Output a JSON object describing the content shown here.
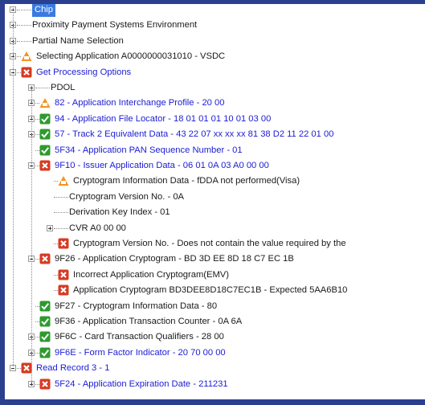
{
  "colors": {
    "frame_border": "#2b3f8f",
    "blue_text": "#1b1bd6",
    "highlight": "#3b7be0",
    "error_red": "#d83a22",
    "warn_orange": "#f39322",
    "ok_green": "#2e9a2e"
  },
  "rows": [
    {
      "text": "Chip",
      "indent": 0,
      "expander": "plus",
      "icon": null,
      "style": "hl"
    },
    {
      "text": "Proximity Payment Systems Environment",
      "indent": 0,
      "expander": "plus",
      "icon": null,
      "style": "normal"
    },
    {
      "text": "Partial Name Selection",
      "indent": 0,
      "expander": "plus",
      "icon": null,
      "style": "normal"
    },
    {
      "text": "Selecting Application A0000000031010 - VSDC",
      "indent": 0,
      "expander": "plus",
      "icon": "warning-icon",
      "style": "normal"
    },
    {
      "text": "Get Processing Options",
      "indent": 0,
      "expander": "minus",
      "icon": "error-icon",
      "style": "blue"
    },
    {
      "text": "PDOL",
      "indent": 1,
      "expander": "plus",
      "icon": null,
      "style": "normal"
    },
    {
      "text": "82 - Application Interchange Profile - 20 00",
      "indent": 1,
      "expander": "plus",
      "icon": "warning-icon",
      "style": "blue"
    },
    {
      "text": "94 - Application File Locator - 18 01 01 01 10 01 03 00",
      "indent": 1,
      "expander": "plus",
      "icon": "check-icon",
      "style": "blue"
    },
    {
      "text": "57 - Track 2 Equivalent Data - 43 22 07 xx xx xx 81 38 D2 11 22 01 00",
      "indent": 1,
      "expander": "plus",
      "icon": "check-icon",
      "style": "blue"
    },
    {
      "text": "5F34 - Application PAN Sequence Number - 01",
      "indent": 1,
      "expander": null,
      "icon": "check-icon",
      "style": "blue"
    },
    {
      "text": "9F10 - Issuer Application Data - 06 01 0A 03 A0 00 00",
      "indent": 1,
      "expander": "minus",
      "icon": "error-icon",
      "style": "blue"
    },
    {
      "text": "Cryptogram Information Data - fDDA not performed(Visa)",
      "indent": 2,
      "expander": null,
      "icon": "warning-icon",
      "style": "normal"
    },
    {
      "text": "Cryptogram Version No. - 0A",
      "indent": 2,
      "expander": null,
      "icon": null,
      "style": "normal"
    },
    {
      "text": "Derivation Key Index - 01",
      "indent": 2,
      "expander": null,
      "icon": null,
      "style": "normal"
    },
    {
      "text": "CVR A0 00 00",
      "indent": 2,
      "expander": "plus",
      "icon": null,
      "style": "normal"
    },
    {
      "text": "Cryptogram Version No. - Does not contain the value required by the",
      "indent": 2,
      "expander": null,
      "icon": "error-icon",
      "style": "normal"
    },
    {
      "text": "9F26 - Application Cryptogram - BD 3D EE 8D 18 C7 EC 1B",
      "indent": 1,
      "expander": "minus",
      "icon": "error-icon",
      "style": "normal"
    },
    {
      "text": "Incorrect Application Cryptogram(EMV)",
      "indent": 2,
      "expander": null,
      "icon": "error-icon",
      "style": "normal"
    },
    {
      "text": "Application Cryptogram BD3DEE8D18C7EC1B - Expected 5AA6B10",
      "indent": 2,
      "expander": null,
      "icon": "error-icon",
      "style": "normal"
    },
    {
      "text": "9F27 - Cryptogram Information Data - 80",
      "indent": 1,
      "expander": null,
      "icon": "check-icon",
      "style": "normal"
    },
    {
      "text": "9F36 - Application Transaction Counter - 0A 6A",
      "indent": 1,
      "expander": null,
      "icon": "check-icon",
      "style": "normal"
    },
    {
      "text": "9F6C - Card Transaction Qualifiers - 28 00",
      "indent": 1,
      "expander": "plus",
      "icon": "check-icon",
      "style": "normal"
    },
    {
      "text": "9F6E - Form Factor Indicator - 20 70 00 00",
      "indent": 1,
      "expander": "plus",
      "icon": "check-icon",
      "style": "blue"
    },
    {
      "text": "Read Record 3 - 1",
      "indent": 0,
      "expander": "minus",
      "icon": "error-icon",
      "style": "blue"
    },
    {
      "text": "5F24 - Application Expiration Date - 211231",
      "indent": 1,
      "expander": "plus",
      "icon": "error-icon",
      "style": "blue"
    }
  ]
}
